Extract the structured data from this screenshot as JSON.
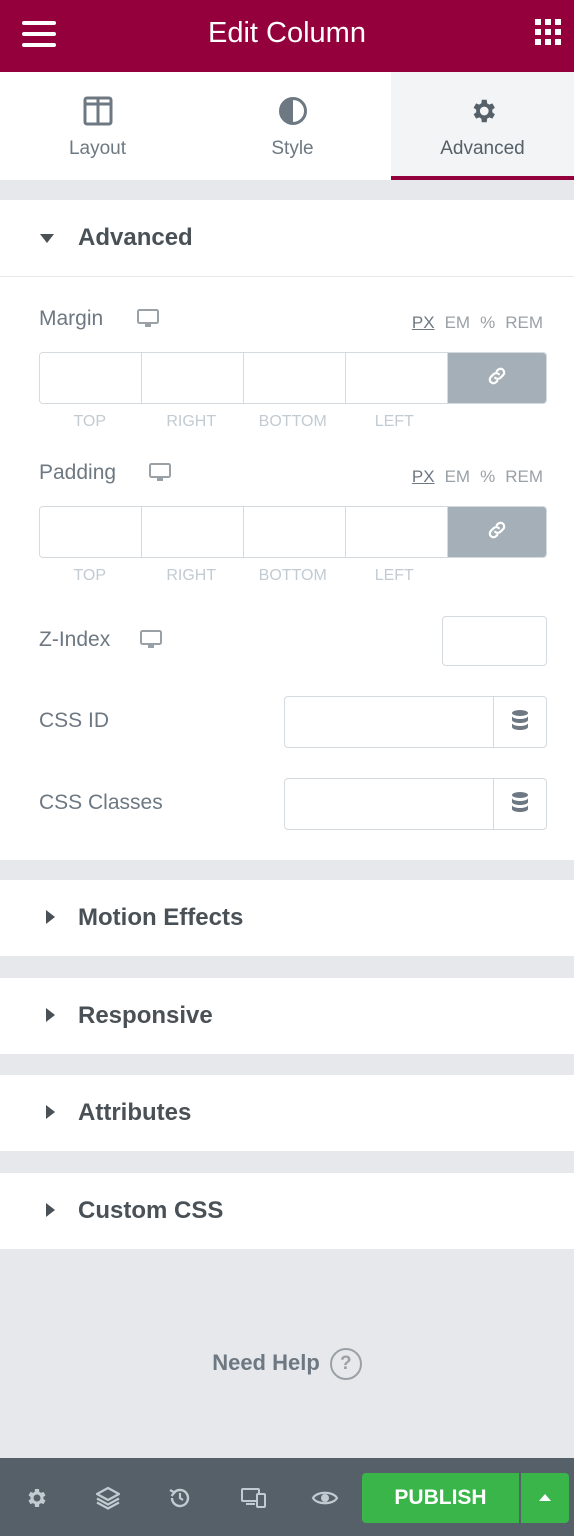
{
  "header": {
    "title": "Edit Column",
    "menu_icon": "hamburger-icon",
    "apps_icon": "grid-icon"
  },
  "tabs": [
    {
      "label": "Layout",
      "icon": "columns-icon"
    },
    {
      "label": "Style",
      "icon": "half-circle-icon"
    },
    {
      "label": "Advanced",
      "icon": "gear-icon",
      "active": true
    }
  ],
  "advanced": {
    "title": "Advanced",
    "margin": {
      "label": "Margin",
      "units": [
        "PX",
        "EM",
        "%",
        "REM"
      ],
      "active_unit": "PX",
      "fields": [
        "TOP",
        "RIGHT",
        "BOTTOM",
        "LEFT"
      ],
      "values": [
        "",
        "",
        "",
        ""
      ]
    },
    "padding": {
      "label": "Padding",
      "units": [
        "PX",
        "EM",
        "%",
        "REM"
      ],
      "active_unit": "PX",
      "fields": [
        "TOP",
        "RIGHT",
        "BOTTOM",
        "LEFT"
      ],
      "values": [
        "",
        "",
        "",
        ""
      ]
    },
    "zindex": {
      "label": "Z-Index",
      "value": ""
    },
    "css_id": {
      "label": "CSS ID",
      "value": ""
    },
    "css_classes": {
      "label": "CSS Classes",
      "value": ""
    }
  },
  "sections": [
    {
      "title": "Motion Effects"
    },
    {
      "title": "Responsive"
    },
    {
      "title": "Attributes"
    },
    {
      "title": "Custom CSS"
    }
  ],
  "help": {
    "label": "Need Help",
    "icon": "question-icon"
  },
  "footer": {
    "publish_label": "PUBLISH",
    "icons": [
      "settings-icon",
      "layers-icon",
      "history-icon",
      "responsive-icon",
      "eye-icon"
    ]
  },
  "colors": {
    "brand": "#93003c",
    "publish": "#39b54a",
    "footer_bg": "#556068",
    "link_button": "#a4afb7"
  }
}
